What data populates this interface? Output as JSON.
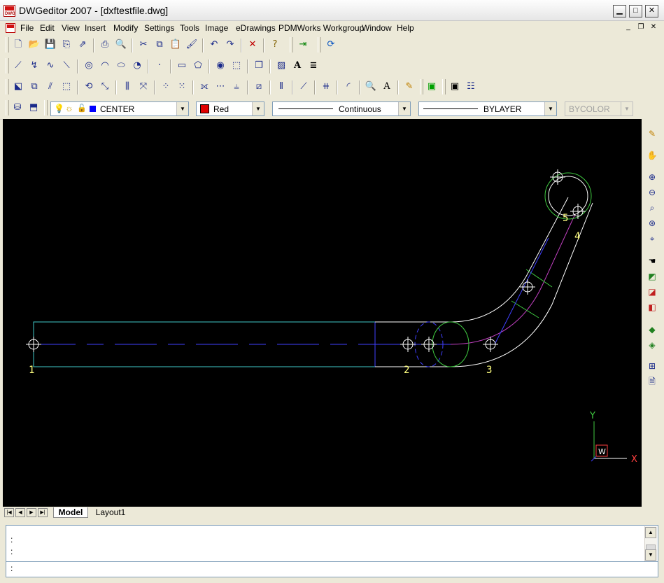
{
  "window": {
    "title": "DWGeditor 2007 - [dxftestfile.dwg]"
  },
  "menu": [
    "File",
    "Edit",
    "View",
    "Insert",
    "Modify",
    "Settings",
    "Tools",
    "Image",
    "eDrawings",
    "PDMWorks Workgroup",
    "Window",
    "Help"
  ],
  "layer_combo": {
    "value": "CENTER"
  },
  "color_combo": {
    "value": "Red",
    "swatch": "#e00000"
  },
  "linetype_combo": {
    "value": "Continuous"
  },
  "lineweight_combo": {
    "value": "BYLAYER"
  },
  "plotstyle_combo": {
    "value": "BYCOLOR"
  },
  "drawing": {
    "point_labels": [
      "1",
      "2",
      "3",
      "4",
      "5"
    ],
    "ucs": {
      "x_label": "X",
      "y_label": "Y",
      "w_label": "W"
    }
  },
  "tabs": {
    "model": "Model",
    "layout1": "Layout1"
  },
  "command": {
    "line1": ":",
    "line2": ":",
    "prompt": ":"
  }
}
